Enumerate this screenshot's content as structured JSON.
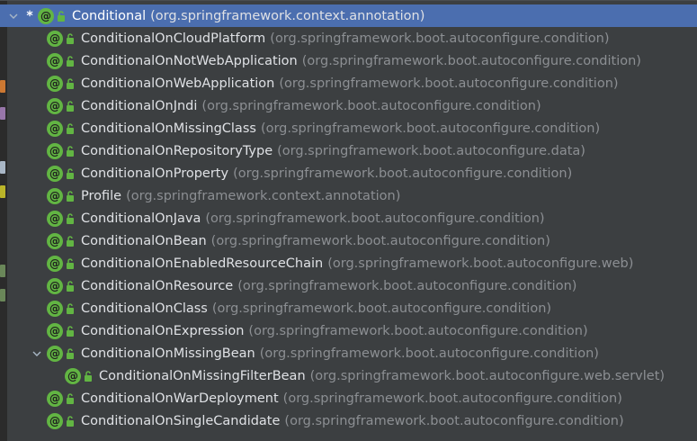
{
  "colors": {
    "background": "#3c3f41",
    "selection": "#4b6eaf",
    "annotation_icon": "#62b543",
    "class_name": "#dfe1e5",
    "package": "#8c8f93"
  },
  "tree": {
    "root": {
      "name": "Conditional",
      "package": "(org.springframework.context.annotation)",
      "marker": "*",
      "expanded": true
    },
    "items": [
      {
        "name": "ConditionalOnCloudPlatform",
        "package": "(org.springframework.boot.autoconfigure.condition)"
      },
      {
        "name": "ConditionalOnNotWebApplication",
        "package": "(org.springframework.boot.autoconfigure.condition)"
      },
      {
        "name": "ConditionalOnWebApplication",
        "package": "(org.springframework.boot.autoconfigure.condition)"
      },
      {
        "name": "ConditionalOnJndi",
        "package": "(org.springframework.boot.autoconfigure.condition)"
      },
      {
        "name": "ConditionalOnMissingClass",
        "package": "(org.springframework.boot.autoconfigure.condition)"
      },
      {
        "name": "ConditionalOnRepositoryType",
        "package": "(org.springframework.boot.autoconfigure.data)"
      },
      {
        "name": "ConditionalOnProperty",
        "package": "(org.springframework.boot.autoconfigure.condition)"
      },
      {
        "name": "Profile",
        "package": "(org.springframework.context.annotation)"
      },
      {
        "name": "ConditionalOnJava",
        "package": "(org.springframework.boot.autoconfigure.condition)"
      },
      {
        "name": "ConditionalOnBean",
        "package": "(org.springframework.boot.autoconfigure.condition)"
      },
      {
        "name": "ConditionalOnEnabledResourceChain",
        "package": "(org.springframework.boot.autoconfigure.web)"
      },
      {
        "name": "ConditionalOnResource",
        "package": "(org.springframework.boot.autoconfigure.condition)"
      },
      {
        "name": "ConditionalOnClass",
        "package": "(org.springframework.boot.autoconfigure.condition)"
      },
      {
        "name": "ConditionalOnExpression",
        "package": "(org.springframework.boot.autoconfigure.condition)"
      },
      {
        "name": "ConditionalOnMissingBean",
        "package": "(org.springframework.boot.autoconfigure.condition)",
        "expanded": true
      },
      {
        "name": "ConditionalOnMissingFilterBean",
        "package": "(org.springframework.boot.autoconfigure.web.servlet)",
        "child": true
      },
      {
        "name": "ConditionalOnWarDeployment",
        "package": "(org.springframework.boot.autoconfigure.condition)"
      },
      {
        "name": "ConditionalOnSingleCandidate",
        "package": "(org.springframework.boot.autoconfigure.condition)"
      }
    ]
  }
}
